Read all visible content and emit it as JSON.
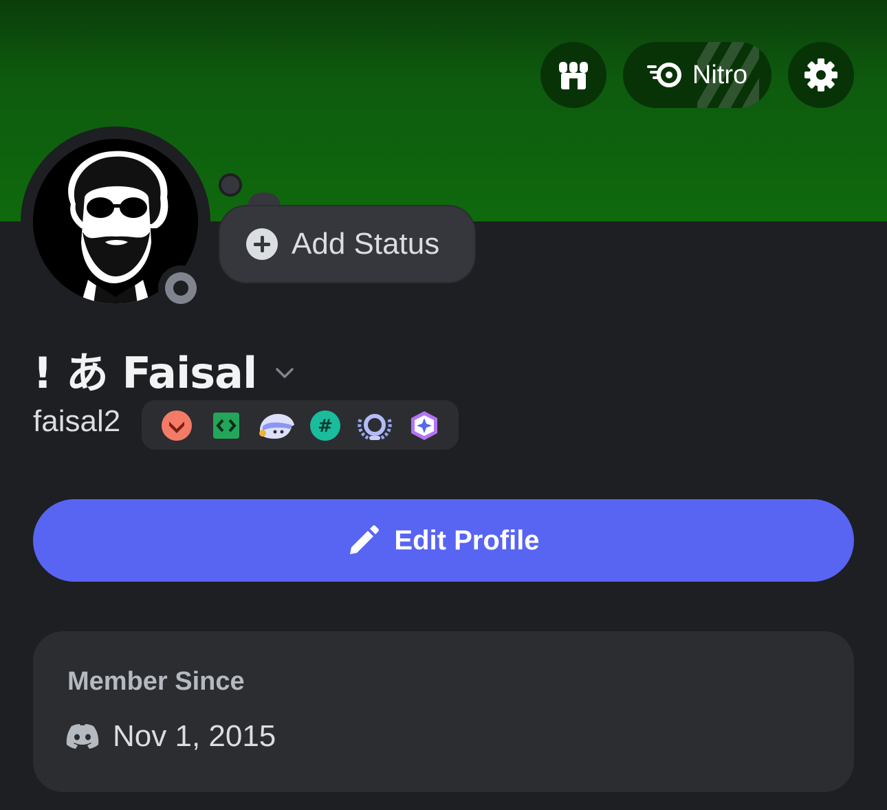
{
  "header": {
    "shop_icon": "shop-icon",
    "nitro_label": "Nitro",
    "nitro_icon": "nitro-icon",
    "settings_icon": "gear-icon",
    "banner_color": "#0f6a0d"
  },
  "profile": {
    "display_name": "! あ Faisal",
    "username": "faisal2",
    "status_action": "Add Status",
    "presence": "offline",
    "badges": [
      {
        "name": "hypesquad-bravery-badge",
        "color": "#f47b67"
      },
      {
        "name": "active-developer-badge",
        "color": "#23a55a"
      },
      {
        "name": "quest-completed-badge",
        "color": "#c9cdfb"
      },
      {
        "name": "moderator-programs-badge",
        "color": "#1abc9c"
      },
      {
        "name": "legacy-username-badge",
        "color": "#9aa4f5"
      },
      {
        "name": "nitro-subscriber-badge",
        "color": "#b473f5"
      }
    ]
  },
  "actions": {
    "edit_profile_label": "Edit Profile",
    "accent": "#5865f2"
  },
  "member_since": {
    "title": "Member Since",
    "date": "Nov 1, 2015",
    "icon": "discord-icon"
  }
}
